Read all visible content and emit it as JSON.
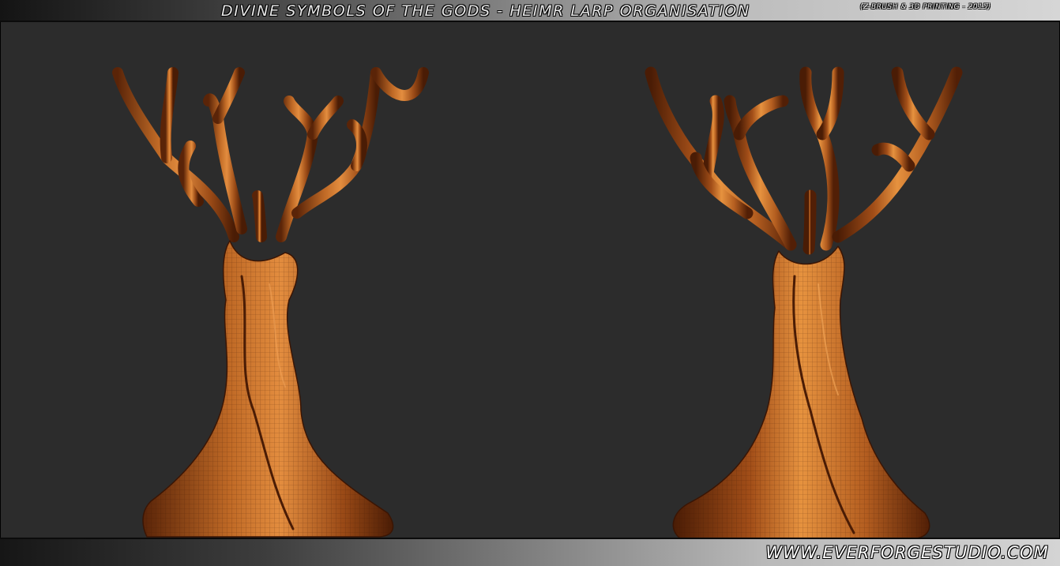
{
  "header": {
    "title": "DIVINE SYMBOLS OF THE GODS - HEIMR LARP ORGANISATION",
    "subtitle": "(Z-BRUSH & 3D PRINTING - 2015)"
  },
  "footer": {
    "website": "WWW.EVERFORGESTUDIO.COM"
  },
  "colors": {
    "background": "#2b2b2b",
    "tree_copper": "#a8561c",
    "tree_highlight": "#e08a3a",
    "tree_shadow": "#4a1e06"
  },
  "scene": {
    "models": [
      "tree-sculpture-front-view",
      "tree-sculpture-angled-view"
    ]
  }
}
